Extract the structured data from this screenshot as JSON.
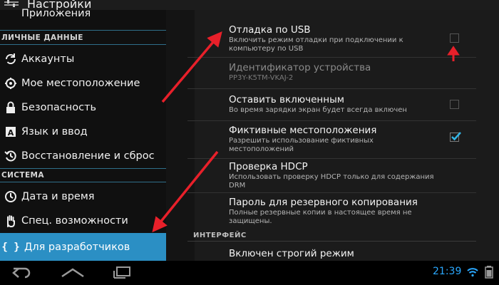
{
  "header": {
    "title": "Настройки"
  },
  "sidebar": {
    "top_item": "Приложения",
    "personal_heading": "ЛИЧНЫЕ ДАННЫЕ",
    "items": [
      {
        "label": "Аккаунты",
        "icon": "sync-icon"
      },
      {
        "label": "Мое местоположение",
        "icon": "location-icon"
      },
      {
        "label": "Безопасность",
        "icon": "lock-icon"
      },
      {
        "label": "Язык и ввод",
        "icon": "keyboard-icon"
      },
      {
        "label": "Восстановление и сброс",
        "icon": "restore-icon"
      }
    ],
    "system_heading": "СИСТЕМА",
    "system_items": [
      {
        "label": "Дата и время",
        "icon": "clock-icon"
      },
      {
        "label": "Спец. возможности",
        "icon": "hand-icon"
      },
      {
        "label": "Для разработчиков",
        "icon": "braces-icon",
        "active": true
      }
    ],
    "active_color": "#2b8fc4"
  },
  "settings": {
    "usb_debug": {
      "title": "Отладка по USB",
      "sub1": "Включить режим отладки при подключении к",
      "sub2": "компьютеру по USB",
      "checked": false
    },
    "device_id": {
      "title": "Идентификатор устройства",
      "sub1": "PP3Y-K5TM-VKAJ-2"
    },
    "stay_awake": {
      "title": "Оставить включенным",
      "sub1": "Во время зарядки экран будет всегда включен",
      "checked": false
    },
    "mock_locations": {
      "title": "Фиктивные местоположения",
      "sub1": "Разрешить использование фиктивных",
      "sub2": "местоположений",
      "checked": true
    },
    "hdcp": {
      "title": "Проверка HDCP",
      "sub1": "Использовать проверку HDCP только для содержания",
      "sub2": "DRM"
    },
    "backup_password": {
      "title": "Пароль для резервного копирования",
      "sub1": "Полные резервные копии в настоящее время не",
      "sub2": "защищены."
    },
    "section_interface": "ИНТЕРФЕЙС",
    "strict_mode": {
      "title": "Включен строгий режим"
    }
  },
  "statusbar": {
    "time": "21:39",
    "accent": "#2aa8ff"
  },
  "annotation_color": "#e8202a"
}
